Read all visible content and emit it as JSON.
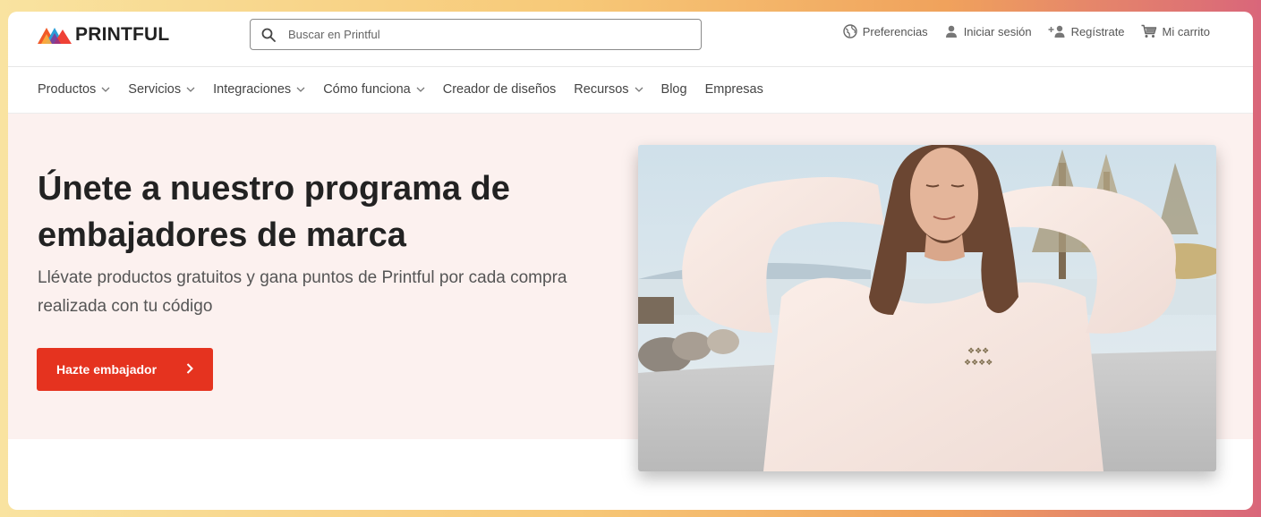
{
  "brand": {
    "name": "PRINTFUL"
  },
  "search": {
    "placeholder": "Buscar en Printful"
  },
  "utilities": [
    {
      "label": "Preferencias",
      "icon": "globe-icon"
    },
    {
      "label": "Iniciar sesión",
      "icon": "user-icon"
    },
    {
      "label": "Regístrate",
      "icon": "add-user-icon"
    },
    {
      "label": "Mi carrito",
      "icon": "cart-icon"
    }
  ],
  "nav": [
    {
      "label": "Productos",
      "dropdown": true
    },
    {
      "label": "Servicios",
      "dropdown": true
    },
    {
      "label": "Integraciones",
      "dropdown": true
    },
    {
      "label": "Cómo funciona",
      "dropdown": true
    },
    {
      "label": "Creador de diseños",
      "dropdown": false
    },
    {
      "label": "Recursos",
      "dropdown": true
    },
    {
      "label": "Blog",
      "dropdown": false
    },
    {
      "label": "Empresas",
      "dropdown": false
    }
  ],
  "hero": {
    "title": "Únete a nuestro programa de embajadores de marca",
    "subtitle": "Llévate productos gratuitos y gana puntos de Printful por cada compra realizada con tu código",
    "cta_label": "Hazte embajador"
  },
  "colors": {
    "accent": "#e5331f",
    "hero_bg": "#fcf1ef",
    "text_dark": "#222222",
    "text_muted": "#555555"
  }
}
